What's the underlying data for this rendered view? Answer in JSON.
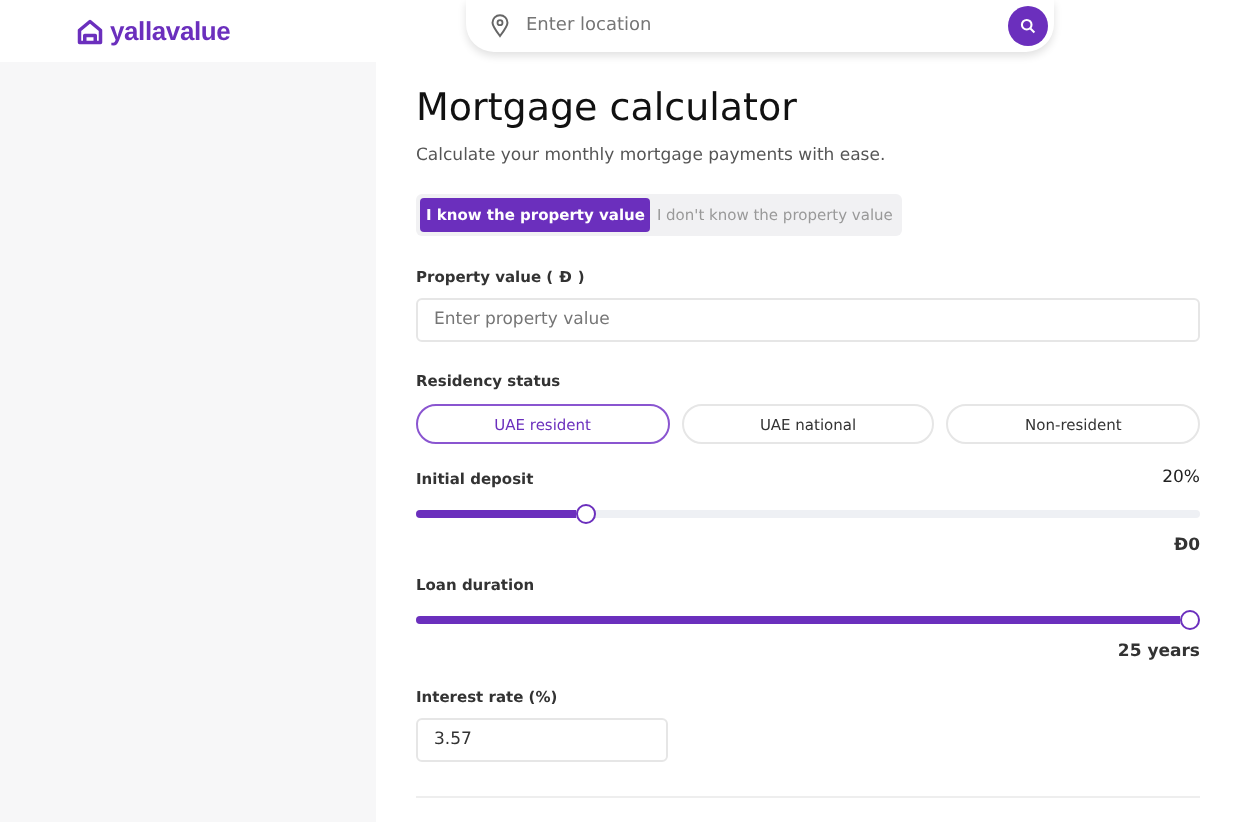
{
  "header": {
    "logo": "yallavalue",
    "search": {
      "placeholder": "Enter location"
    }
  },
  "title": "Mortgage calculator",
  "subtitle": "Calculate your monthly mortgage payments with ease.",
  "tabs": [
    {
      "label": "I know the property value",
      "selected": true
    },
    {
      "label": "I don't know the property value",
      "selected": false
    }
  ],
  "property_value": {
    "label": "Property value (",
    "currency": "Đ",
    "label_end": ")",
    "placeholder": "Enter property value"
  },
  "residency": {
    "label": "Residency status",
    "options": [
      {
        "label": "UAE resident",
        "selected": true
      },
      {
        "label": "UAE national",
        "selected": false
      },
      {
        "label": "Non-resident",
        "selected": false
      }
    ]
  },
  "initial_deposit": {
    "label": "Initial deposit",
    "percent": "20%",
    "level": 0.21,
    "reading": "Đ0"
  },
  "loan_duration": {
    "label": "Loan duration",
    "level": 1,
    "reading": "25 years"
  },
  "interest_rate": {
    "label": "Interest rate (%)",
    "value": "3.57"
  }
}
